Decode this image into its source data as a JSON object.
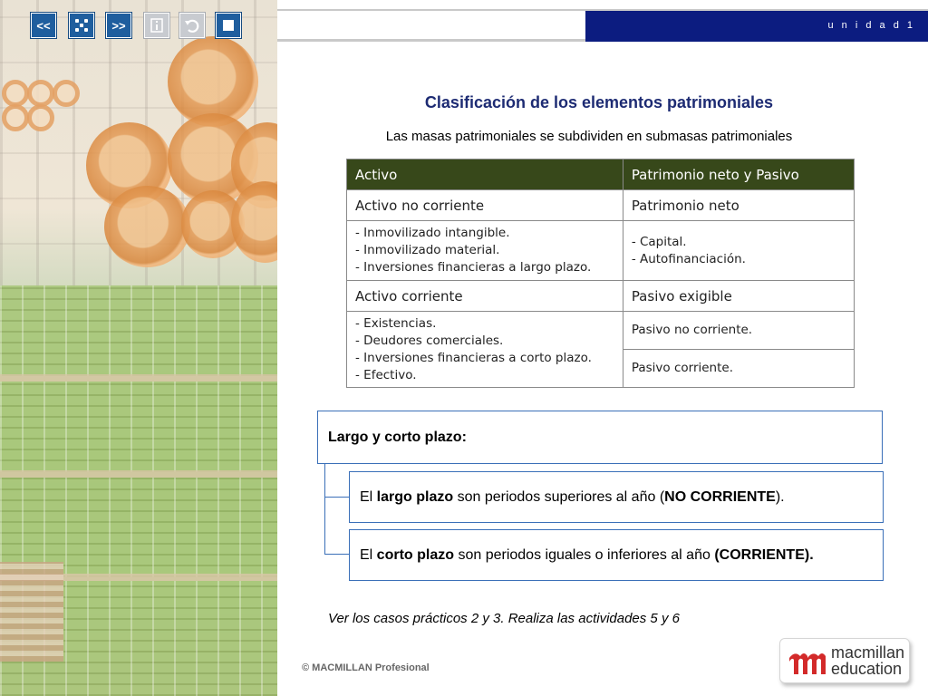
{
  "toolbar": {
    "prev_label": "<<",
    "next_label": ">>",
    "icons": [
      "dice-icon",
      "info-icon",
      "undo-icon",
      "stop-icon"
    ]
  },
  "header": {
    "unit_label": "u n i d a d  1",
    "accent_color": "#0c1c80"
  },
  "slide": {
    "title": "Clasificación de los elementos patrimoniales",
    "subtitle": "Las masas patrimoniales se subdividen en submasas patrimoniales"
  },
  "table": {
    "headers": [
      "Activo",
      "Patrimonio neto y Pasivo"
    ],
    "header_color": "#37481a",
    "activo_no_corriente": "Activo no corriente",
    "patrimonio_neto": "Patrimonio neto",
    "anc_items": [
      "- Inmovilizado intangible.",
      "- Inmovilizado material.",
      "- Inversiones financieras a largo plazo."
    ],
    "pn_items": [
      "- Capital.",
      "- Autofinanciación."
    ],
    "activo_corriente": "Activo corriente",
    "pasivo_exigible": "Pasivo exigible",
    "ac_items": [
      "- Existencias.",
      "- Deudores comerciales.",
      "- Inversiones financieras a corto plazo.",
      "- Efectivo."
    ],
    "pasivo_no_corriente": "Pasivo no corriente.",
    "pasivo_corriente": "Pasivo corriente."
  },
  "plazo": {
    "heading": "Largo y corto plazo:",
    "long": {
      "t1": "El ",
      "b1": "largo plazo",
      "t2": " son periodos superiores al año (",
      "b2": "NO CORRIENTE",
      "t3": ")."
    },
    "short": {
      "t1": "El ",
      "b1": "corto plazo",
      "t2": " son periodos iguales o inferiores al año ",
      "b2": "(CORRIENTE)."
    }
  },
  "note": "Ver los casos prácticos 2 y 3. Realiza las actividades 5 y 6",
  "footer": {
    "copyright": "© MACMILLAN Profesional",
    "logo_line1": "macmillan",
    "logo_line2": "education"
  }
}
